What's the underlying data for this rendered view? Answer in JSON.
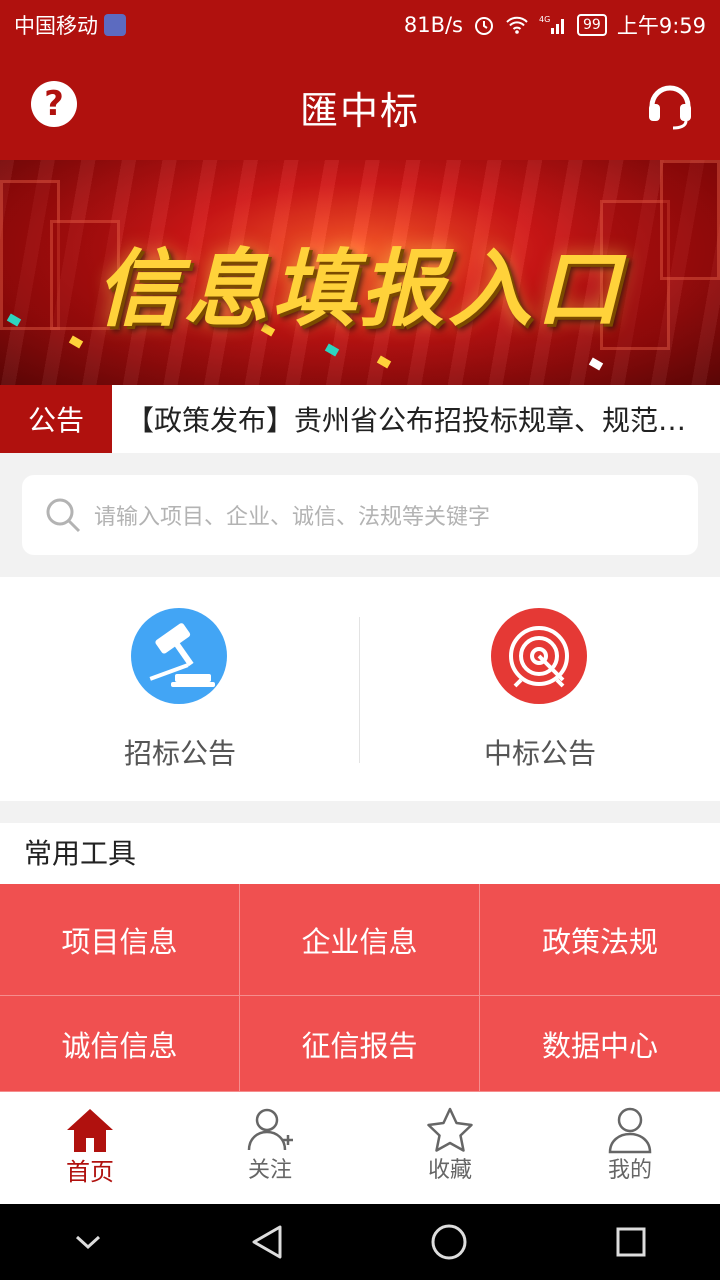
{
  "status_bar": {
    "carrier": "中国移动",
    "net_speed": "81B/s",
    "battery": "99",
    "time": "上午9:59"
  },
  "app_bar": {
    "title": "匯中标",
    "help_icon": "question-icon",
    "service_icon": "headset-icon"
  },
  "banner": {
    "heading": "信息填报入口"
  },
  "notice": {
    "tag": "公告",
    "text": "【政策发布】贵州省公布招投标规章、规范…"
  },
  "search": {
    "placeholder": "请输入项目、企业、诚信、法规等关键字"
  },
  "quick_entries": [
    {
      "label": "招标公告",
      "icon": "gavel-icon",
      "color": "#42a5f5"
    },
    {
      "label": "中标公告",
      "icon": "target-icon",
      "color": "#e53935"
    }
  ],
  "tools": {
    "title": "常用工具",
    "items": [
      {
        "label": "项目信息"
      },
      {
        "label": "企业信息"
      },
      {
        "label": "政策法规"
      },
      {
        "label": "诚信信息"
      },
      {
        "label": "征信报告"
      },
      {
        "label": "数据中心"
      }
    ]
  },
  "tab_bar": {
    "items": [
      {
        "label": "首页",
        "icon": "home-icon",
        "active": true
      },
      {
        "label": "关注",
        "icon": "add-user-icon",
        "active": false
      },
      {
        "label": "收藏",
        "icon": "star-icon",
        "active": false
      },
      {
        "label": "我的",
        "icon": "person-icon",
        "active": false
      }
    ]
  },
  "colors": {
    "brand": "#b0110e",
    "tool_bg": "#f05050",
    "accent_blue": "#42a5f5"
  }
}
